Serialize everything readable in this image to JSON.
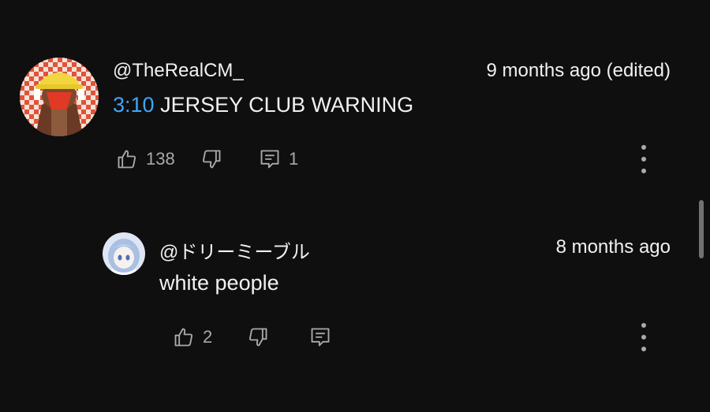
{
  "comments": [
    {
      "author": "@TheRealCM_",
      "time": "9 months ago (edited)",
      "timestamp_link": "3:10",
      "text": " JERSEY CLUB WARNING",
      "likes": "138",
      "replies": "1",
      "avatar_icon": "avatar-checker-character"
    },
    {
      "author": "@ドリーミーブル",
      "time": "8 months ago",
      "text": "white people",
      "likes": "2",
      "avatar_icon": "avatar-anime-girl"
    }
  ],
  "icons": {
    "like": "thumbs-up-icon",
    "dislike": "thumbs-down-icon",
    "reply": "comment-icon",
    "more": "more-vertical-icon"
  },
  "colors": {
    "background": "#0f0f0f",
    "text": "#f1f1f1",
    "secondary": "#aaaaaa",
    "link": "#3ea6ff"
  }
}
